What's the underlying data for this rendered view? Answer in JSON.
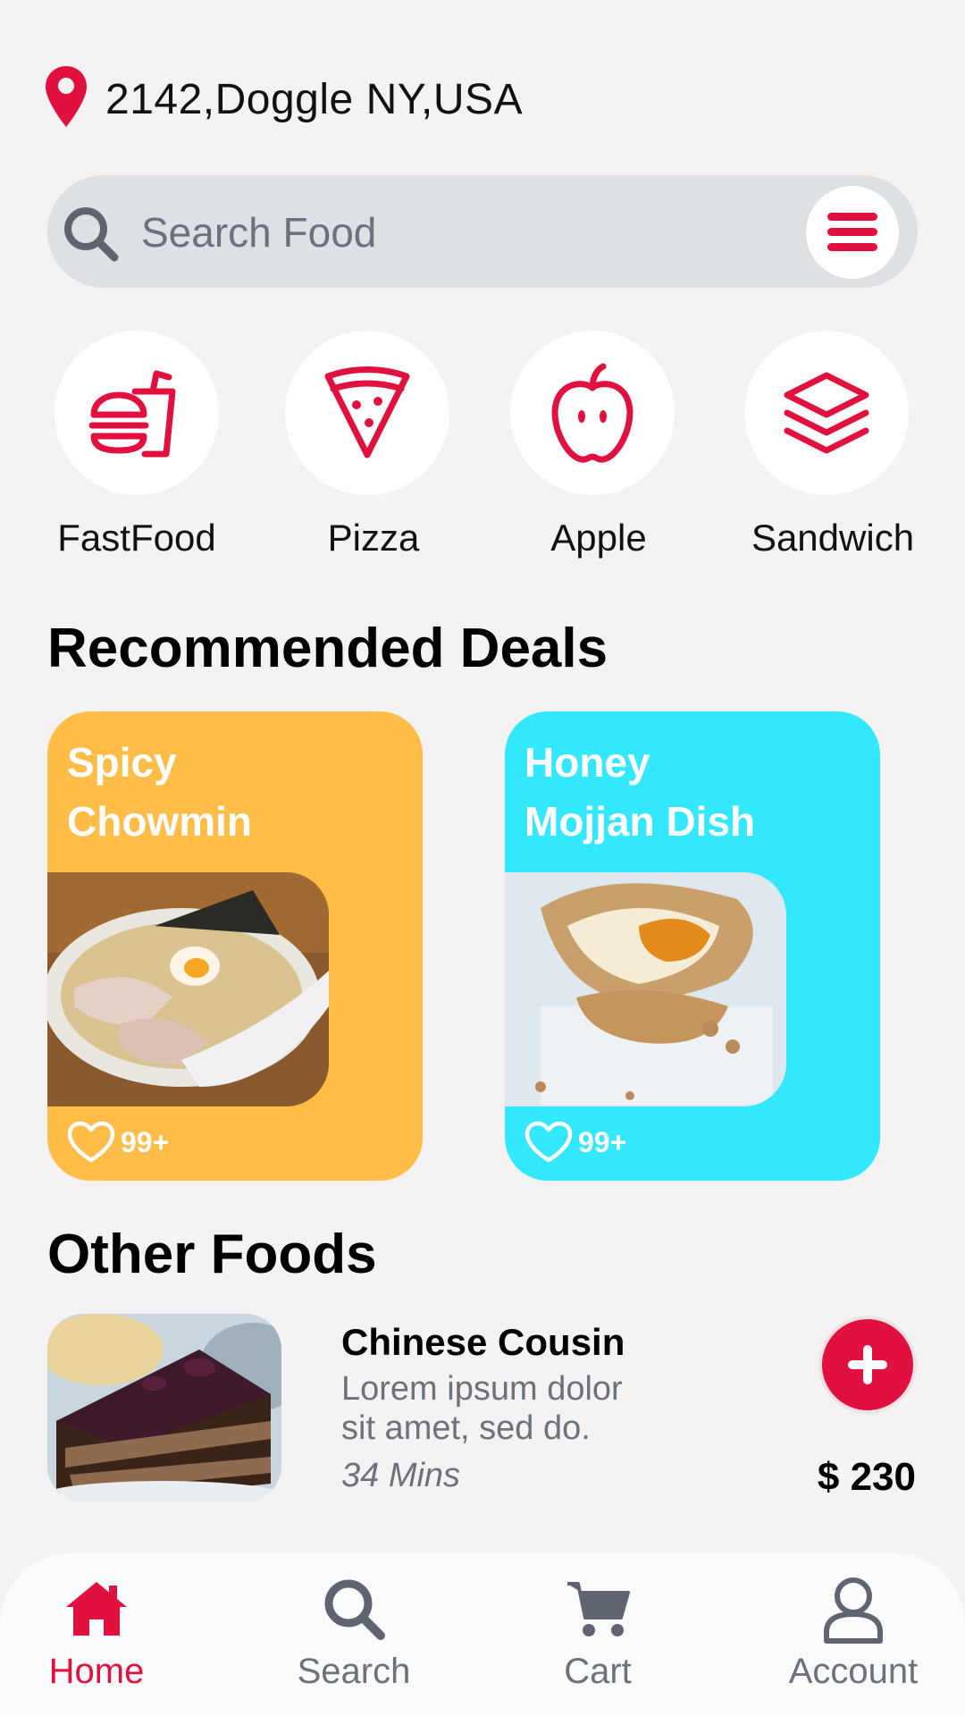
{
  "location": {
    "address": "2142,Doggle NY,USA"
  },
  "search": {
    "placeholder": "Search Food"
  },
  "categories": [
    {
      "label": "FastFood",
      "icon": "fastfood-icon"
    },
    {
      "label": "Pizza",
      "icon": "pizza-icon"
    },
    {
      "label": "Apple",
      "icon": "apple-icon"
    },
    {
      "label": "Sandwich",
      "icon": "sandwich-icon"
    }
  ],
  "recommended": {
    "title": "Recommended Deals",
    "deals": [
      {
        "title_line1": "Spicy",
        "title_line2": "Chowmin",
        "likes": "99+",
        "color": "#fdbd47"
      },
      {
        "title_line1": "Honey",
        "title_line2": "Mojjan Dish",
        "likes": "99+",
        "color": "#33e8fd"
      }
    ]
  },
  "other": {
    "title": "Other Foods",
    "items": [
      {
        "name": "Chinese Cousin",
        "desc": "Lorem ipsum dolor sit amet, sed do.",
        "time": "34 Mins",
        "price": "$ 230"
      }
    ]
  },
  "nav": [
    {
      "label": "Home",
      "icon": "home-icon",
      "active": true
    },
    {
      "label": "Search",
      "icon": "search-icon",
      "active": false
    },
    {
      "label": "Cart",
      "icon": "cart-icon",
      "active": false
    },
    {
      "label": "Account",
      "icon": "account-icon",
      "active": false
    }
  ],
  "colors": {
    "accent": "#e0103f",
    "background": "#f5f2f4",
    "muted": "#6c727b"
  }
}
